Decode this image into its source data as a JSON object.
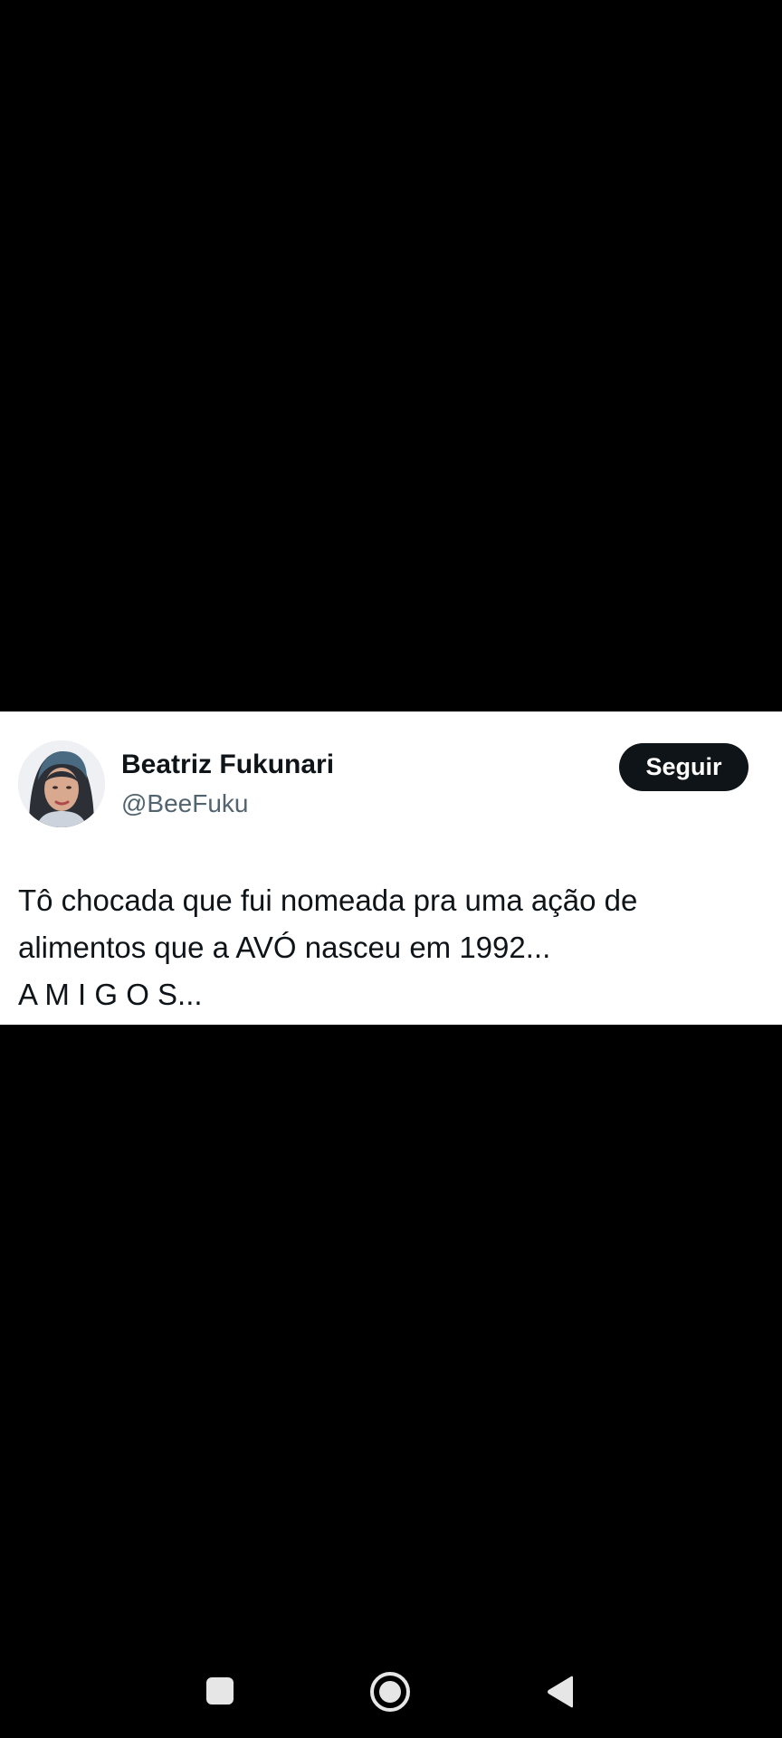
{
  "tweet": {
    "author": {
      "display_name": "Beatriz Fukunari",
      "handle": "@BeeFuku",
      "avatar_icon": "profile-photo-avatar"
    },
    "follow_label": "Seguir",
    "text_lines": [
      "Tô chocada que fui nomeada pra uma ação de",
      "alimentos que a AVÓ nasceu em 1992...",
      "A M I G O S..."
    ]
  },
  "navigation_bar": {
    "recents_icon": "square-recents-icon",
    "home_icon": "circle-home-icon",
    "back_icon": "triangle-back-icon"
  },
  "colors": {
    "background": "#000000",
    "card": "#ffffff",
    "text_primary": "#0f1419",
    "text_secondary": "#536471",
    "button_bg": "#0f1419",
    "button_text": "#ffffff",
    "nav_icon": "#e6e6e6"
  }
}
